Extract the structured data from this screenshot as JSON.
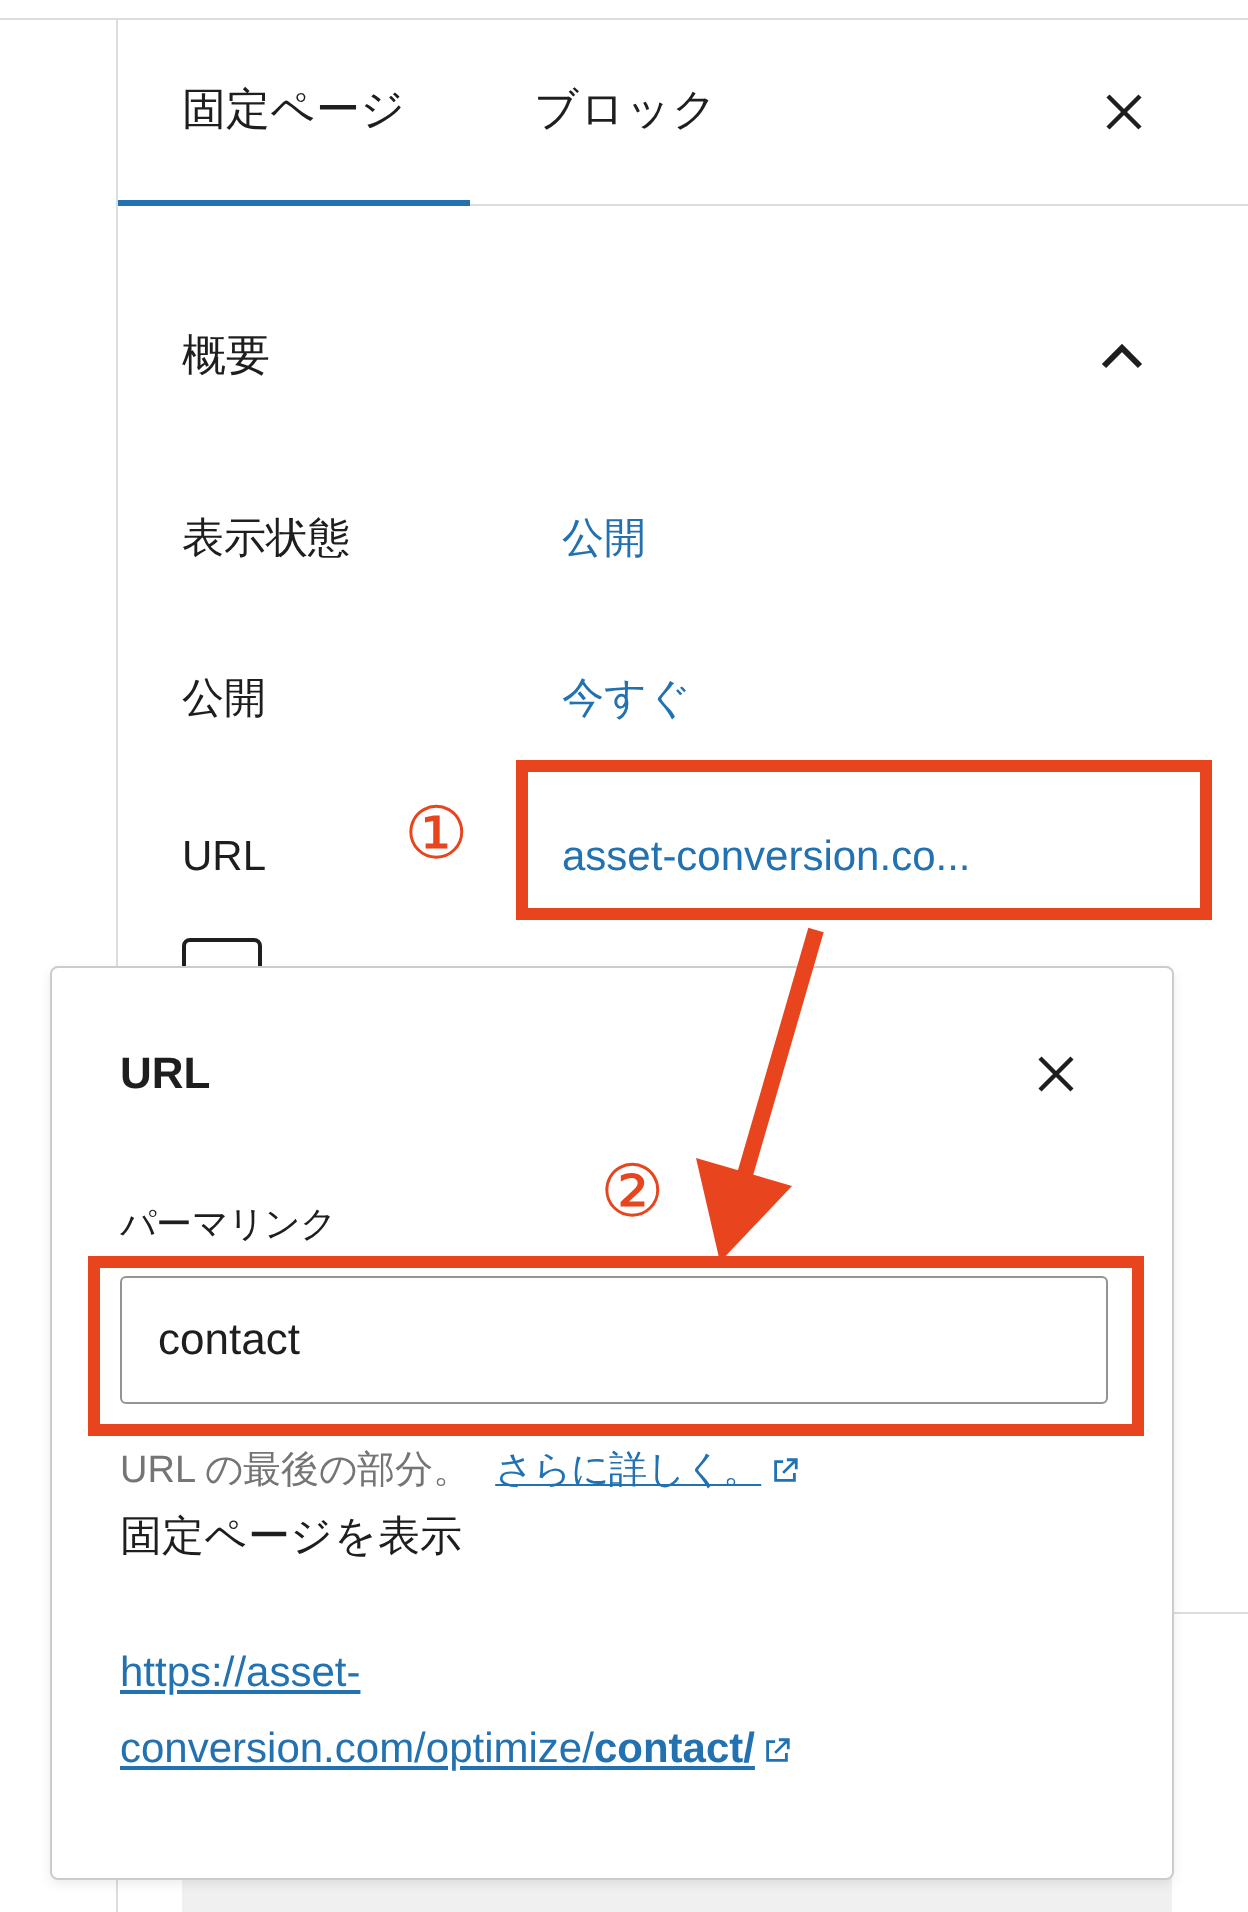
{
  "tabs": [
    {
      "label": "固定ページ",
      "selected": true
    },
    {
      "label": "ブロック",
      "selected": false
    }
  ],
  "summary": {
    "title": "概要",
    "expanded": true,
    "checkbox_checked": false,
    "rows": [
      {
        "label": "表示状態",
        "value": "公開"
      },
      {
        "label": "公開",
        "value": "今すぐ"
      },
      {
        "label": "URL",
        "value": "asset-conversion.co..."
      }
    ]
  },
  "popover": {
    "title": "URL",
    "field_label": "パーマリンク",
    "field_value": "contact",
    "help_text": "URL の最後の部分。",
    "help_link": "さらに詳しく。",
    "view_label": "固定ページを表示",
    "url_lines": [
      "https://asset-",
      "conversion.com/optimize/**contact/**"
    ]
  },
  "callouts": [
    {
      "number": "①"
    },
    {
      "number": "②"
    }
  ]
}
